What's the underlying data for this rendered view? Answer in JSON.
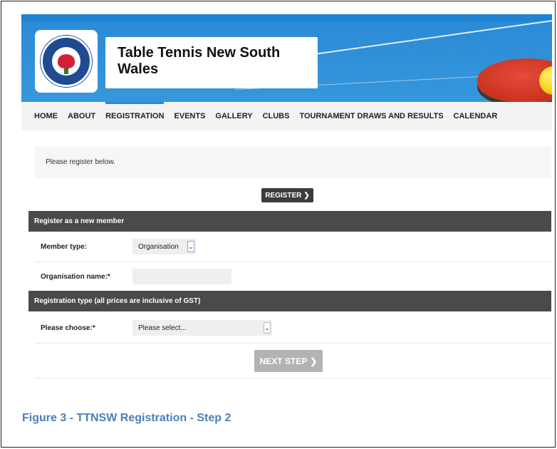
{
  "header": {
    "site_title": "Table Tennis New South Wales",
    "logo_text": "TABLE TENNIS NEW SOUTH WALES"
  },
  "nav": {
    "items": [
      {
        "label": "HOME"
      },
      {
        "label": "ABOUT"
      },
      {
        "label": "REGISTRATION",
        "active": true
      },
      {
        "label": "EVENTS"
      },
      {
        "label": "GALLERY"
      },
      {
        "label": "CLUBS"
      },
      {
        "label": "TOURNAMENT DRAWS AND RESULTS"
      },
      {
        "label": "CALENDAR"
      }
    ]
  },
  "notice": {
    "text": "Please register below."
  },
  "register_button": {
    "label": "REGISTER",
    "icon": "chevron-right-icon"
  },
  "section_new_member": {
    "title": "Register as a new member"
  },
  "member_type": {
    "label": "Member type:",
    "value": "Organisation"
  },
  "organisation_name": {
    "label": "Organisation name:*",
    "value": ""
  },
  "section_registration_type": {
    "title": "Registration type (all prices are inclusive of GST)"
  },
  "please_choose": {
    "label": "Please choose:*",
    "value": "Please select..."
  },
  "next_button": {
    "label": "NEXT STEP",
    "icon": "chevron-right-icon"
  },
  "caption": {
    "text": "Figure 3 - TTNSW Registration - Step 2"
  },
  "colors": {
    "banner_blue": "#2f8fd8",
    "dark_header": "#4a4a4a",
    "caption_blue": "#4a7fb8",
    "next_button_grey": "#b3b3b3"
  }
}
